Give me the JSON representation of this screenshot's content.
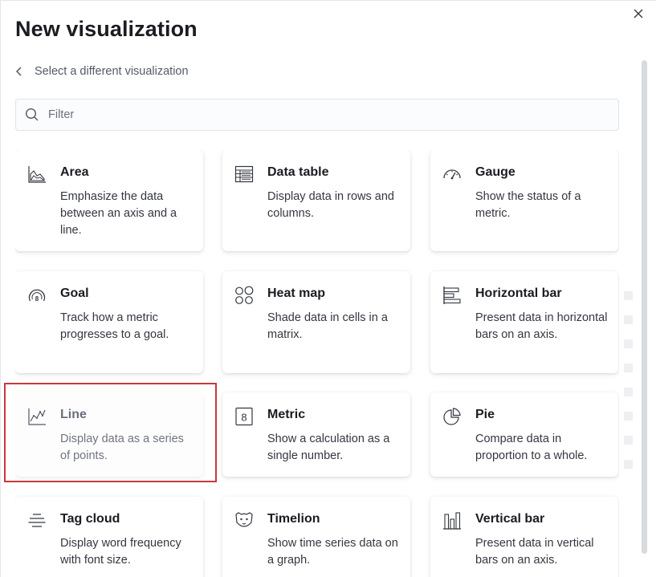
{
  "modal": {
    "title": "New visualization",
    "back_label": "Select a different visualization",
    "filter_placeholder": "Filter"
  },
  "cards": [
    {
      "name": "Area",
      "description": "Emphasize the data between an axis and a line.",
      "icon": "area-chart-icon"
    },
    {
      "name": "Data table",
      "description": "Display data in rows and columns.",
      "icon": "table-icon"
    },
    {
      "name": "Gauge",
      "description": "Show the status of a metric.",
      "icon": "gauge-icon"
    },
    {
      "name": "Goal",
      "description": "Track how a metric progresses to a goal.",
      "icon": "goal-icon"
    },
    {
      "name": "Heat map",
      "description": "Shade data in cells in a matrix.",
      "icon": "heatmap-icon"
    },
    {
      "name": "Horizontal bar",
      "description": "Present data in horizontal bars on an axis.",
      "icon": "horizontal-bar-icon"
    },
    {
      "name": "Line",
      "description": "Display data as a series of points.",
      "icon": "line-chart-icon"
    },
    {
      "name": "Metric",
      "description": "Show a calculation as a single number.",
      "icon": "metric-icon"
    },
    {
      "name": "Pie",
      "description": "Compare data in proportion to a whole.",
      "icon": "pie-chart-icon"
    },
    {
      "name": "Tag cloud",
      "description": "Display word frequency with font size.",
      "icon": "tag-cloud-icon"
    },
    {
      "name": "Timelion",
      "description": "Show time series data on a graph.",
      "icon": "timelion-icon"
    },
    {
      "name": "Vertical bar",
      "description": "Present data in vertical bars on an axis.",
      "icon": "vertical-bar-icon"
    }
  ],
  "highlight_color": "#c8383c",
  "metric_icon_text": "8"
}
